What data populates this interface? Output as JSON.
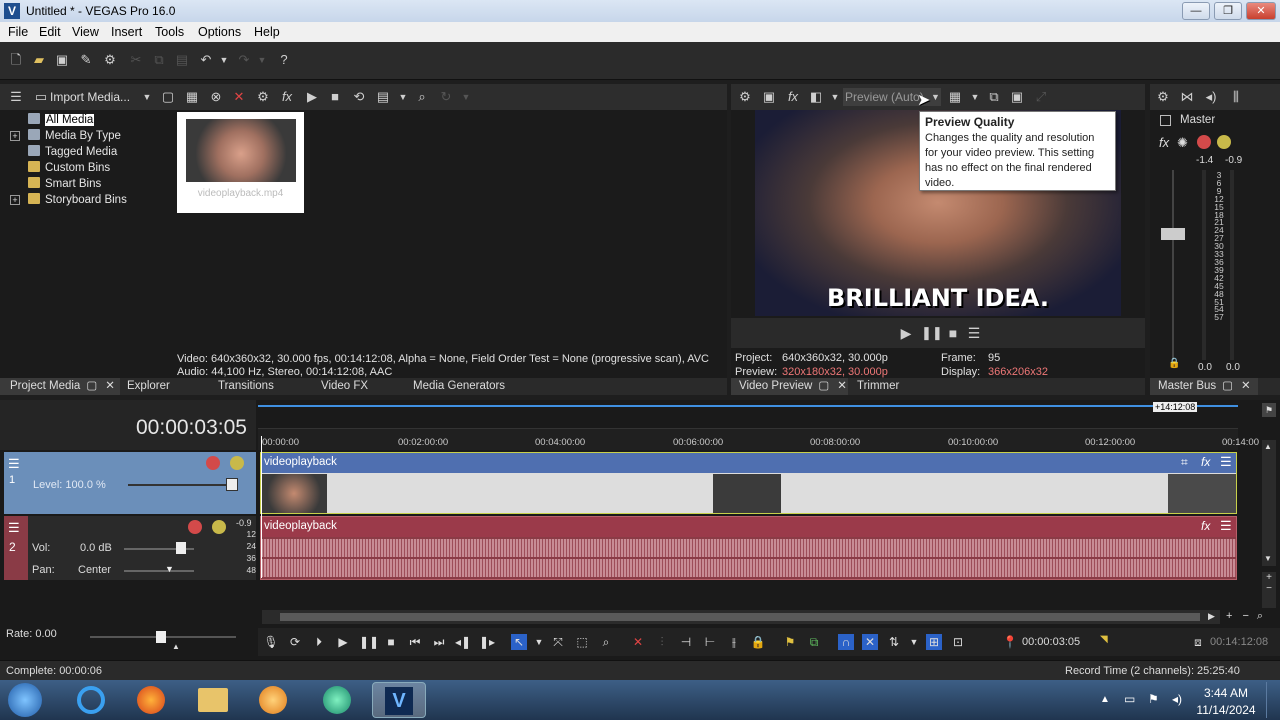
{
  "window": {
    "title": "Untitled * - VEGAS Pro 16.0",
    "app_icon_letter": "V",
    "min": "—",
    "max": "❐",
    "close": "✕"
  },
  "menu": [
    "File",
    "Edit",
    "View",
    "Insert",
    "Tools",
    "Options",
    "Help"
  ],
  "project_media": {
    "import_label": "Import Media...",
    "tree": [
      "All Media",
      "Media By Type",
      "Tagged Media",
      "Custom Bins",
      "Smart Bins",
      "Storyboard Bins"
    ],
    "thumb_label": "videoplayback.mp4",
    "info_line1": "Video: 640x360x32, 30.000 fps, 00:14:12:08, Alpha = None, Field Order Test = None (progressive scan), AVC",
    "info_line2": "Audio: 44,100 Hz, Stereo, 00:14:12:08, AAC"
  },
  "left_tabs": [
    "Project Media",
    "Explorer",
    "Transitions",
    "Video FX",
    "Media Generators"
  ],
  "preview": {
    "quality_label": "Preview (Auto)",
    "caption": "BRILLIANT IDEA.",
    "project_label": "Project:",
    "project_value": "640x360x32, 30.000p",
    "preview_label": "Preview:",
    "preview_value": "320x180x32, 30.000p",
    "frame_label": "Frame:",
    "frame_value": "95",
    "display_label": "Display:",
    "display_value": "366x206x32",
    "tabs": [
      "Video Preview",
      "Trimmer"
    ]
  },
  "tooltip": {
    "title": "Preview Quality",
    "body": "Changes the quality and resolution for your video preview. This setting has no effect on the final rendered video."
  },
  "master": {
    "label": "Master",
    "peak_left": "-1.4",
    "peak_right": "-0.9",
    "scale": [
      "3",
      "6",
      "9",
      "12",
      "15",
      "18",
      "21",
      "24",
      "27",
      "30",
      "33",
      "36",
      "39",
      "42",
      "45",
      "48",
      "51",
      "54",
      "57"
    ],
    "val_left": "0.0",
    "val_right": "0.0",
    "tab": "Master Bus"
  },
  "timeline": {
    "timecode": "00:00:03:05",
    "end_marker": "+14:12:08",
    "ruler": [
      "00:00:00",
      "00:02:00:00",
      "00:04:00:00",
      "00:06:00:00",
      "00:08:00:00",
      "00:10:00:00",
      "00:12:00:00",
      "00:14:00"
    ],
    "track1": {
      "number": "1",
      "level_label": "Level: 100.0 %",
      "clip_name": "videoplayback"
    },
    "track2": {
      "number": "2",
      "vol_label": "Vol:",
      "vol_value": "0.0 dB",
      "pan_label": "Pan:",
      "pan_value": "Center",
      "meter": "-0.9",
      "scale": [
        "12",
        "24",
        "36",
        "48"
      ],
      "clip_name": "videoplayback"
    },
    "rate_label": "Rate: 0.00",
    "cursor_time": "00:00:03:05",
    "end_time": "00:14:12:08"
  },
  "status": {
    "left": "Complete: 00:00:06",
    "right": "Record Time (2 channels): 25:25:40"
  },
  "taskbar": {
    "time": "3:44 AM",
    "date": "11/14/2024"
  },
  "colors": {
    "video_track": "#6b8fba",
    "audio_track": "#8a3b46",
    "video_clip_header": "#4f6fb0",
    "audio_clip_header": "#9b3a4a",
    "accent": "#2b62c8"
  }
}
